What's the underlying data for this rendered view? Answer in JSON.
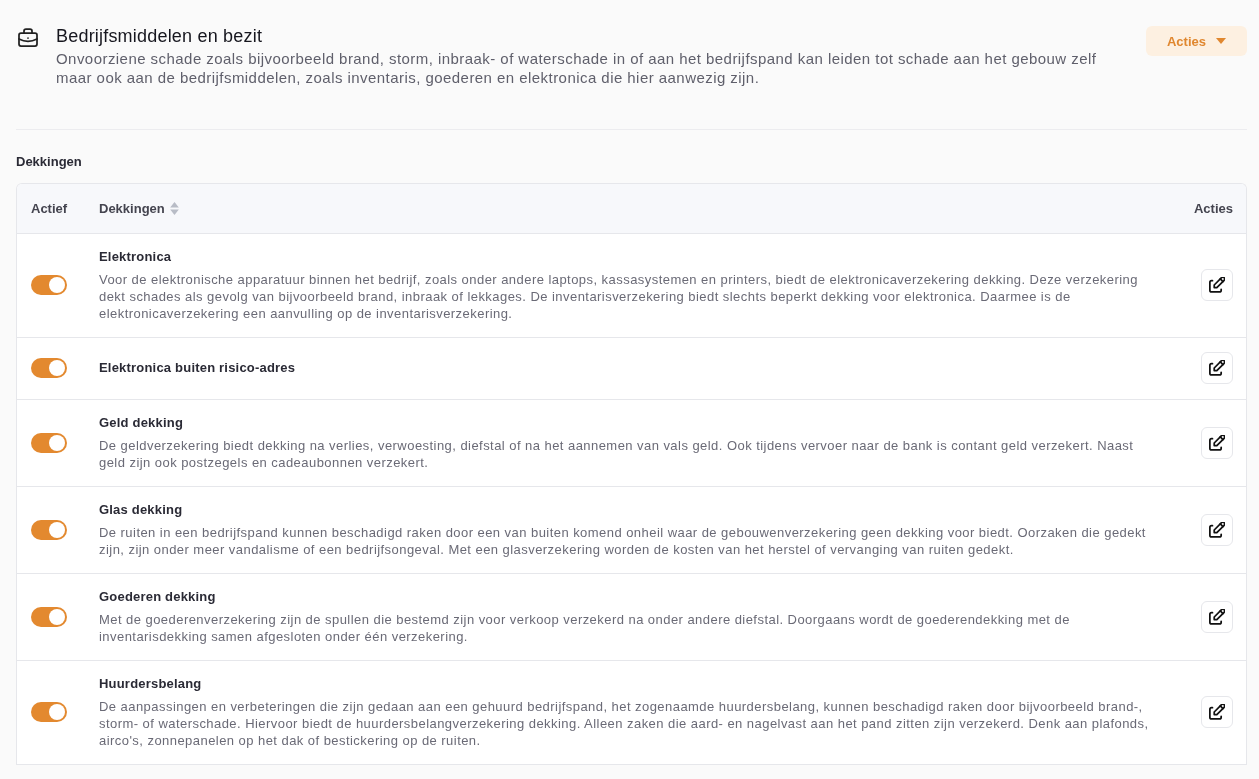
{
  "section": {
    "title": "Bedrijfsmiddelen en bezit",
    "description": "Onvoorziene schade zoals bijvoorbeeld brand, storm, inbraak- of waterschade in of aan het bedrijfspand kan leiden tot schade aan het gebouw zelf maar ook aan de bedrijfsmiddelen, zoals inventaris, goederen en elektronica die hier aanwezig zijn.",
    "actions_button": {
      "label": "Acties"
    }
  },
  "coverages_heading": "Dekkingen",
  "table": {
    "columns": [
      {
        "label": "Actief",
        "sortable": false
      },
      {
        "label": "Dekkingen",
        "sortable": true
      },
      {
        "label": "Acties",
        "sortable": false
      }
    ],
    "rows": [
      {
        "name": "Elektronica",
        "description": "Voor de elektronische apparatuur binnen het bedrijf, zoals onder andere laptops, kassasystemen en printers, biedt de elektronicaverzekering dekking. Deze verzekering dekt schades als gevolg van bijvoorbeeld brand, inbraak of lekkages. De inventarisverzekering biedt slechts beperkt dekking voor elektronica. Daarmee is de elektronicaverzekering een aanvulling op de inventarisverzekering.",
        "active": true
      },
      {
        "name": "Elektronica buiten risico-adres",
        "active": true
      },
      {
        "name": "Geld dekking",
        "description": "De geldverzekering biedt dekking na verlies, verwoesting, diefstal of na het aannemen van vals geld. Ook tijdens vervoer naar de bank is contant geld verzekert. Naast geld zijn ook postzegels en cadeaubonnen verzekert.",
        "active": true
      },
      {
        "name": "Glas dekking",
        "description": "De ruiten in een bedrijfspand kunnen beschadigd raken door een van buiten komend onheil waar de gebouwenverzekering geen dekking voor biedt. Oorzaken die gedekt zijn, zijn onder meer vandalisme of een bedrijfsongeval. Met een glasverzekering worden de kosten van het herstel of vervanging van ruiten gedekt.",
        "active": true
      },
      {
        "name": "Goederen dekking",
        "description": "Met de goederenverzekering zijn de spullen die bestemd zijn voor verkoop verzekerd na onder andere diefstal. Doorgaans wordt de goederendekking met de inventarisdekking samen afgesloten onder één verzekering.",
        "active": true
      },
      {
        "name": "Huurdersbelang",
        "description": "De aanpassingen en verbeteringen die zijn gedaan aan een gehuurd bedrijfspand, het zogenaamde huurdersbelang, kunnen beschadigd raken door bijvoorbeeld brand-, storm- of waterschade. Hiervoor biedt de huurdersbelangverzekering dekking. Alleen zaken die aard- en nagelvast aan het pand zitten zijn verzekerd. Denk aan plafonds, airco's, zonnepanelen op het dak of bestickering op de ruiten.",
        "active": true
      }
    ]
  }
}
